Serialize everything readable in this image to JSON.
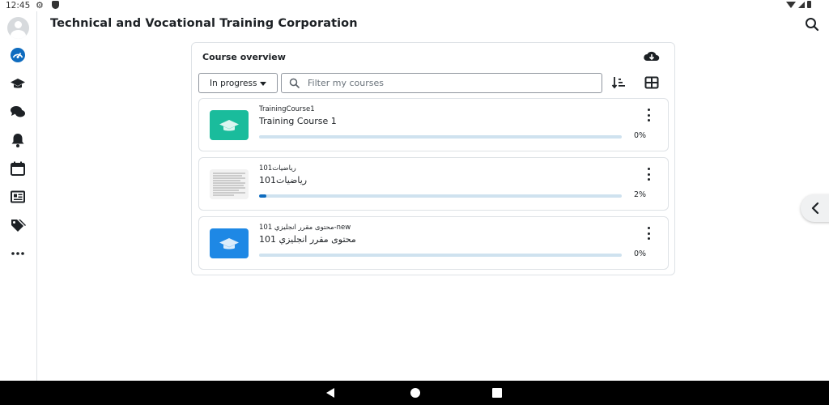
{
  "status_bar": {
    "time": "12:45"
  },
  "header": {
    "title": "Technical and Vocational Training Corporation"
  },
  "sidebar": {
    "items": [
      {
        "name": "dashboard",
        "icon": "dashboard-gauge-icon"
      },
      {
        "name": "my-courses",
        "icon": "graduation-cap-icon"
      },
      {
        "name": "messages",
        "icon": "chat-bubbles-icon"
      },
      {
        "name": "notifications",
        "icon": "bell-icon"
      },
      {
        "name": "calendar",
        "icon": "calendar-icon"
      },
      {
        "name": "site-news",
        "icon": "newspaper-icon"
      },
      {
        "name": "tags",
        "icon": "tags-icon"
      },
      {
        "name": "more",
        "icon": "more-dots-icon"
      }
    ],
    "active_color": "#0f6cbf"
  },
  "overview": {
    "title": "Course overview",
    "filter_selected": "In progress",
    "search_placeholder": "Filter my courses"
  },
  "courses": [
    {
      "category": "TrainingCourse1",
      "name": "Training Course 1",
      "progress": 0,
      "progress_label": "0%",
      "image": "cap-tile",
      "color": "#1abc9c"
    },
    {
      "category": "رياضيات101",
      "name": "رياضيات101",
      "progress": 2,
      "progress_label": "2%",
      "image": "document-thumbnail",
      "color": "#f4f4f4"
    },
    {
      "category": "محتوى مقرر انجليزي 101-new",
      "name": "محتوى مقرر انجليزي 101",
      "progress": 0,
      "progress_label": "0%",
      "image": "cap-tile",
      "color": "#1e88e5"
    }
  ],
  "colors": {
    "accent": "#0f6cbf",
    "track": "#cfe2ef",
    "border": "#dee2e6"
  }
}
